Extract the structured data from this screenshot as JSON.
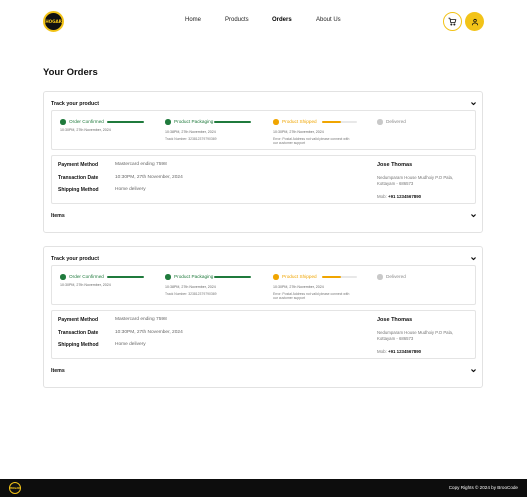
{
  "header": {
    "logo_text": "HOGAR",
    "nav": [
      "Home",
      "Products",
      "Orders",
      "About Us"
    ],
    "active_nav": "Orders",
    "cart_icon": "cart-icon",
    "user_icon": "user-icon"
  },
  "page_title": "Your Orders",
  "colors": {
    "brand_yellow": "#f2c318",
    "done_green": "#1f7a3c",
    "current_orange": "#f0a500",
    "pending_gray": "#c9c9c9"
  },
  "orders": [
    {
      "track_title": "Track your product",
      "steps": [
        {
          "label": "Order Confirmed",
          "time": "10:30PM, 27th November, 2024",
          "sub": ""
        },
        {
          "label": "Product Packaging",
          "time": "10:38PM, 27th November, 2024",
          "sub": "Track Number: 323812379790369"
        },
        {
          "label": "Product Shipped",
          "time": "10:30PM, 27th November, 2024",
          "sub": "Error: Postal Address not valid please connect with our customer support"
        },
        {
          "label": "Delivered",
          "time": "",
          "sub": ""
        }
      ],
      "payment_label": "Payment Method",
      "payment_value": "Mastercard ending 7598",
      "transaction_label": "Transaction Date",
      "transaction_value": "10:30PM, 27th November, 2024",
      "shipping_label": "Shipping Method",
      "shipping_value": "Home delivery",
      "customer_name": "Jose Thomas",
      "address_line1": "Nedumparam House Mudhoiy P.O Pala,",
      "address_line2": "Kottayam - 686573",
      "mobile_label": "Mob:",
      "mobile_value": "+91 1234567890",
      "items_label": "Items"
    },
    {
      "track_title": "Track your product",
      "steps": [
        {
          "label": "Order Confirmed",
          "time": "10:30PM, 27th November, 2024",
          "sub": ""
        },
        {
          "label": "Product Packaging",
          "time": "10:38PM, 27th November, 2024",
          "sub": "Track Number: 323812379790369"
        },
        {
          "label": "Product Shipped",
          "time": "10:30PM, 27th November, 2024",
          "sub": "Error: Postal Address not valid please connect with our customer support"
        },
        {
          "label": "Delivered",
          "time": "",
          "sub": ""
        }
      ],
      "payment_label": "Payment Method",
      "payment_value": "Mastercard ending 7598",
      "transaction_label": "Transaction Date",
      "transaction_value": "10:30PM, 27th November, 2024",
      "shipping_label": "Shipping Method",
      "shipping_value": "Home delivery",
      "customer_name": "Jose Thomas",
      "address_line1": "Nedumparam House Mudhoiy P.O Pala,",
      "address_line2": "Kottayam - 686573",
      "mobile_label": "Mob:",
      "mobile_value": "+91 1234567890",
      "items_label": "Items"
    }
  ],
  "footer": {
    "logo_text": "HOGAR",
    "copyright": "Copy Rights © 2024 by BrooCode"
  }
}
